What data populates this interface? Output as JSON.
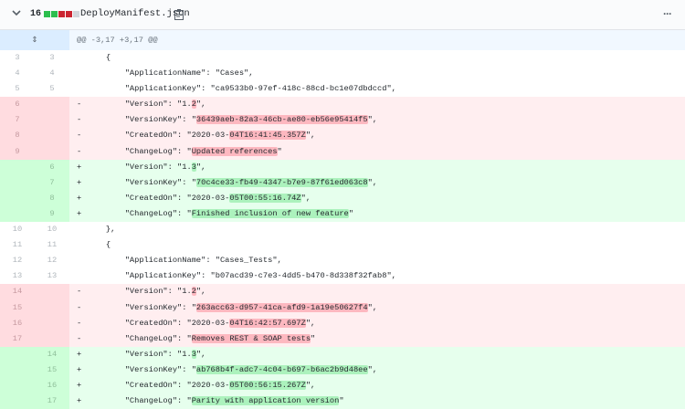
{
  "file": {
    "changes": "16",
    "name": "DeployManifest.json",
    "bar_colors": [
      "#2cbe4e",
      "#2cbe4e",
      "#cb2431",
      "#cb2431",
      "#d1d5da"
    ]
  },
  "hunk": {
    "header": "@@ -3,17 +3,17 @@"
  },
  "rows": [
    {
      "type": "ctx",
      "old": "3",
      "new": "3",
      "sign": "",
      "segs": [
        {
          "t": "    {"
        }
      ]
    },
    {
      "type": "ctx",
      "old": "4",
      "new": "4",
      "sign": "",
      "segs": [
        {
          "t": "        \"ApplicationName\": \"Cases\","
        }
      ]
    },
    {
      "type": "ctx",
      "old": "5",
      "new": "5",
      "sign": "",
      "segs": [
        {
          "t": "        \"ApplicationKey\": \"ca9533b0-97ef-418c-88cd-bc1e07dbdccd\","
        }
      ]
    },
    {
      "type": "del",
      "old": "6",
      "new": "",
      "sign": "-",
      "segs": [
        {
          "t": "        \"Version\": \"1."
        },
        {
          "t": "2",
          "h": 1
        },
        {
          "t": "\","
        }
      ]
    },
    {
      "type": "del",
      "old": "7",
      "new": "",
      "sign": "-",
      "segs": [
        {
          "t": "        \"VersionKey\": \""
        },
        {
          "t": "36439aeb-82a3-46cb-ae80-eb56e95414f5",
          "h": 1
        },
        {
          "t": "\","
        }
      ]
    },
    {
      "type": "del",
      "old": "8",
      "new": "",
      "sign": "-",
      "segs": [
        {
          "t": "        \"CreatedOn\": \"2020-03-"
        },
        {
          "t": "04T16:41:45.357Z",
          "h": 1
        },
        {
          "t": "\","
        }
      ]
    },
    {
      "type": "del",
      "old": "9",
      "new": "",
      "sign": "-",
      "segs": [
        {
          "t": "        \"ChangeLog\": \""
        },
        {
          "t": "Updated references",
          "h": 1
        },
        {
          "t": "\""
        }
      ]
    },
    {
      "type": "add",
      "old": "",
      "new": "6",
      "sign": "+",
      "segs": [
        {
          "t": "        \"Version\": \"1."
        },
        {
          "t": "3",
          "h": 1
        },
        {
          "t": "\","
        }
      ]
    },
    {
      "type": "add",
      "old": "",
      "new": "7",
      "sign": "+",
      "segs": [
        {
          "t": "        \"VersionKey\": \""
        },
        {
          "t": "70c4ce33-fb49-4347-b7e9-87f61ed063c8",
          "h": 1
        },
        {
          "t": "\","
        }
      ]
    },
    {
      "type": "add",
      "old": "",
      "new": "8",
      "sign": "+",
      "segs": [
        {
          "t": "        \"CreatedOn\": \"2020-03-"
        },
        {
          "t": "05T00:55:16.74Z",
          "h": 1
        },
        {
          "t": "\","
        }
      ]
    },
    {
      "type": "add",
      "old": "",
      "new": "9",
      "sign": "+",
      "segs": [
        {
          "t": "        \"ChangeLog\": \""
        },
        {
          "t": "Finished inclusion of new feature",
          "h": 1
        },
        {
          "t": "\""
        }
      ]
    },
    {
      "type": "ctx",
      "old": "10",
      "new": "10",
      "sign": "",
      "segs": [
        {
          "t": "    },"
        }
      ]
    },
    {
      "type": "ctx",
      "old": "11",
      "new": "11",
      "sign": "",
      "segs": [
        {
          "t": "    {"
        }
      ]
    },
    {
      "type": "ctx",
      "old": "12",
      "new": "12",
      "sign": "",
      "segs": [
        {
          "t": "        \"ApplicationName\": \"Cases_Tests\","
        }
      ]
    },
    {
      "type": "ctx",
      "old": "13",
      "new": "13",
      "sign": "",
      "segs": [
        {
          "t": "        \"ApplicationKey\": \"b07acd39-c7e3-4dd5-b470-8d338f32fab8\","
        }
      ]
    },
    {
      "type": "del",
      "old": "14",
      "new": "",
      "sign": "-",
      "segs": [
        {
          "t": "        \"Version\": \"1."
        },
        {
          "t": "2",
          "h": 1
        },
        {
          "t": "\","
        }
      ]
    },
    {
      "type": "del",
      "old": "15",
      "new": "",
      "sign": "-",
      "segs": [
        {
          "t": "        \"VersionKey\": \""
        },
        {
          "t": "263acc63-d957-41ca-afd9-1a19e50627f4",
          "h": 1
        },
        {
          "t": "\","
        }
      ]
    },
    {
      "type": "del",
      "old": "16",
      "new": "",
      "sign": "-",
      "segs": [
        {
          "t": "        \"CreatedOn\": \"2020-03-"
        },
        {
          "t": "04T16:42:57.697Z",
          "h": 1
        },
        {
          "t": "\","
        }
      ]
    },
    {
      "type": "del",
      "old": "17",
      "new": "",
      "sign": "-",
      "segs": [
        {
          "t": "        \"ChangeLog\": \""
        },
        {
          "t": "Removes REST & SOAP tests",
          "h": 1
        },
        {
          "t": "\""
        }
      ]
    },
    {
      "type": "add",
      "old": "",
      "new": "14",
      "sign": "+",
      "segs": [
        {
          "t": "        \"Version\": \"1."
        },
        {
          "t": "3",
          "h": 1
        },
        {
          "t": "\","
        }
      ]
    },
    {
      "type": "add",
      "old": "",
      "new": "15",
      "sign": "+",
      "segs": [
        {
          "t": "        \"VersionKey\": \""
        },
        {
          "t": "ab768b4f-adc7-4c04-b697-b6ac2b9d48ee",
          "h": 1
        },
        {
          "t": "\","
        }
      ]
    },
    {
      "type": "add",
      "old": "",
      "new": "16",
      "sign": "+",
      "segs": [
        {
          "t": "        \"CreatedOn\": \"2020-03-"
        },
        {
          "t": "05T00:56:15.267Z",
          "h": 1
        },
        {
          "t": "\","
        }
      ]
    },
    {
      "type": "add",
      "old": "",
      "new": "17",
      "sign": "+",
      "segs": [
        {
          "t": "        \"ChangeLog\": \""
        },
        {
          "t": "Parity with application version",
          "h": 1
        },
        {
          "t": "\""
        }
      ]
    }
  ]
}
